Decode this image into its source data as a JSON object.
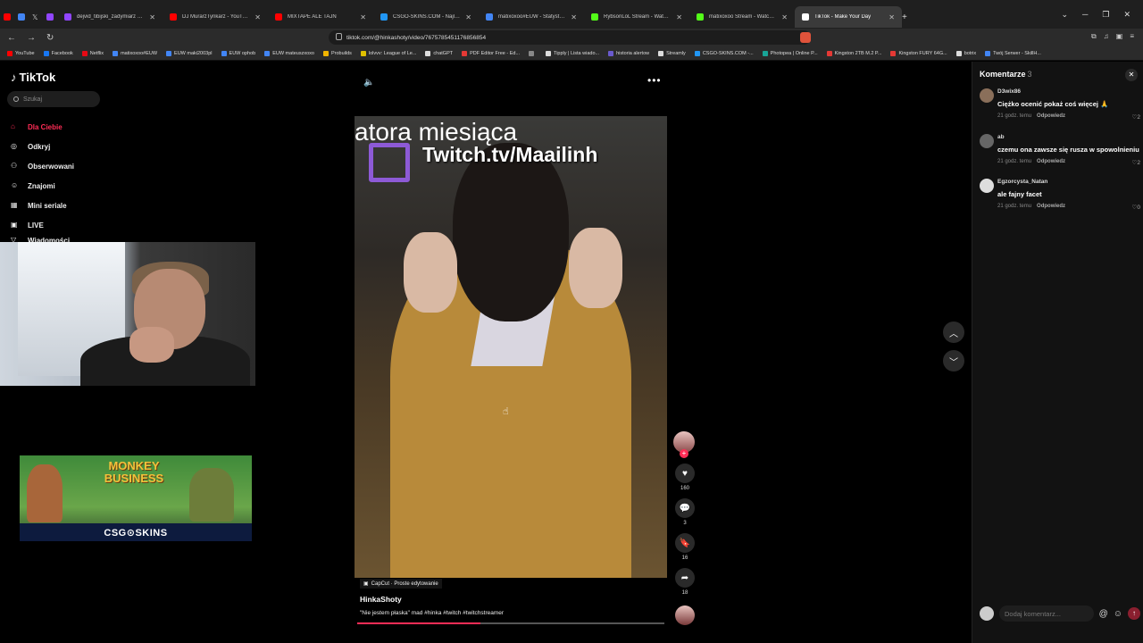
{
  "browser": {
    "tabs": [
      {
        "label": "dejvid_tibijski_zadymiarz - Twitch",
        "color": "#9146ff",
        "active": false
      },
      {
        "label": "DJ MurarzTynkarz - YouTube",
        "color": "#ff0000",
        "active": false
      },
      {
        "label": "MIXTAPE ALE TAJN",
        "color": "#ff0000",
        "active": false
      },
      {
        "label": "CSGO-SKINS.COM - Najlepsze Skrzy",
        "color": "#2196f3",
        "active": false
      },
      {
        "label": "matixoxoo#EUW - Statystyki przyw",
        "color": "#4285f4",
        "active": false
      },
      {
        "label": "RybsonLoL Stream - Watch Live on K",
        "color": "#53fc18",
        "active": false
      },
      {
        "label": "matixoxoo Stream - Watch Live on K",
        "color": "#53fc18",
        "active": false
      },
      {
        "label": "TikTok - Make Your Day",
        "color": "#ffffff",
        "active": true
      }
    ],
    "url": "tiktok.com/@hinkashoty/video/7675785451176856854",
    "bookmarks": [
      {
        "label": "YouTube",
        "color": "#ff0000"
      },
      {
        "label": "Facebook",
        "color": "#1877f2"
      },
      {
        "label": "Netflix",
        "color": "#e50914"
      },
      {
        "label": "matixoxoo#EUW",
        "color": "#4285f4"
      },
      {
        "label": "EUW maki2003pl",
        "color": "#4285f4"
      },
      {
        "label": "EUW ophob",
        "color": "#4285f4"
      },
      {
        "label": "EUW mateuszxoxo",
        "color": "#4285f4"
      },
      {
        "label": "Probuilds",
        "color": "#f0b400"
      },
      {
        "label": "lolvvv: League of Le...",
        "color": "#e0c000"
      },
      {
        "label": "chatGPT",
        "color": "#dddddd"
      },
      {
        "label": "PDF Editor Free - Ed...",
        "color": "#e53935"
      },
      {
        "label": "",
        "color": "#888888"
      },
      {
        "label": "Tipply | Lista wiado...",
        "color": "#dddddd"
      },
      {
        "label": "historia alertow",
        "color": "#6a5acd"
      },
      {
        "label": "Streamly",
        "color": "#dddddd"
      },
      {
        "label": "CSGO-SKINS.COM -...",
        "color": "#2196f3"
      },
      {
        "label": "Photopea | Online P...",
        "color": "#18a497"
      },
      {
        "label": "Kingston 2TB M.2 P...",
        "color": "#e53935"
      },
      {
        "label": "Kingston FURY 64G...",
        "color": "#e53935"
      },
      {
        "label": "botrix",
        "color": "#dddddd"
      },
      {
        "label": "Twój Serwer - SkillH...",
        "color": "#4285f4"
      }
    ]
  },
  "sidebar": {
    "logo": "TikTok",
    "search_placeholder": "Szukaj",
    "items": [
      {
        "label": "Dla Ciebie",
        "active": true
      },
      {
        "label": "Odkryj",
        "active": false
      },
      {
        "label": "Obserwowani",
        "active": false
      },
      {
        "label": "Znajomi",
        "active": false
      },
      {
        "label": "Mini seriale",
        "active": false
      },
      {
        "label": "LIVE",
        "active": false
      },
      {
        "label": "Wiadomości",
        "active": false
      }
    ]
  },
  "ad": {
    "title": "MONKEY BUSINESS",
    "brand": "CSG⊙SKINS"
  },
  "video": {
    "caption_top": "atora miesiąca",
    "caption_twitch": "Twitch.tv/Maailinh",
    "capcut_label": "CapCut · Proste edytowanie",
    "author": "HinkaShoty",
    "description": "\"Nie jestem płaska\" mad #hinka #twitch #twitchstreamer",
    "progress": 0.4
  },
  "actions": {
    "likes": "160",
    "comments": "3",
    "saves": "16",
    "shares": "18"
  },
  "comments_panel": {
    "title": "Komentarze",
    "count": "3",
    "input_placeholder": "Dodaj komentarz...",
    "items": [
      {
        "user": "D3wix86",
        "text": "Ciężko ocenić pokaż coś więcej 🙏",
        "time": "21 godz. temu",
        "reply": "Odpowiedz",
        "likes": "2"
      },
      {
        "user": "ab",
        "text": "czemu ona zawsze się rusza w spowolnieniu",
        "time": "21 godz. temu",
        "reply": "Odpowiedz",
        "likes": "2"
      },
      {
        "user": "Egzorcysta_Natan",
        "text": "ale fajny facet",
        "time": "21 godz. temu",
        "reply": "Odpowiedz",
        "likes": "0"
      }
    ]
  }
}
